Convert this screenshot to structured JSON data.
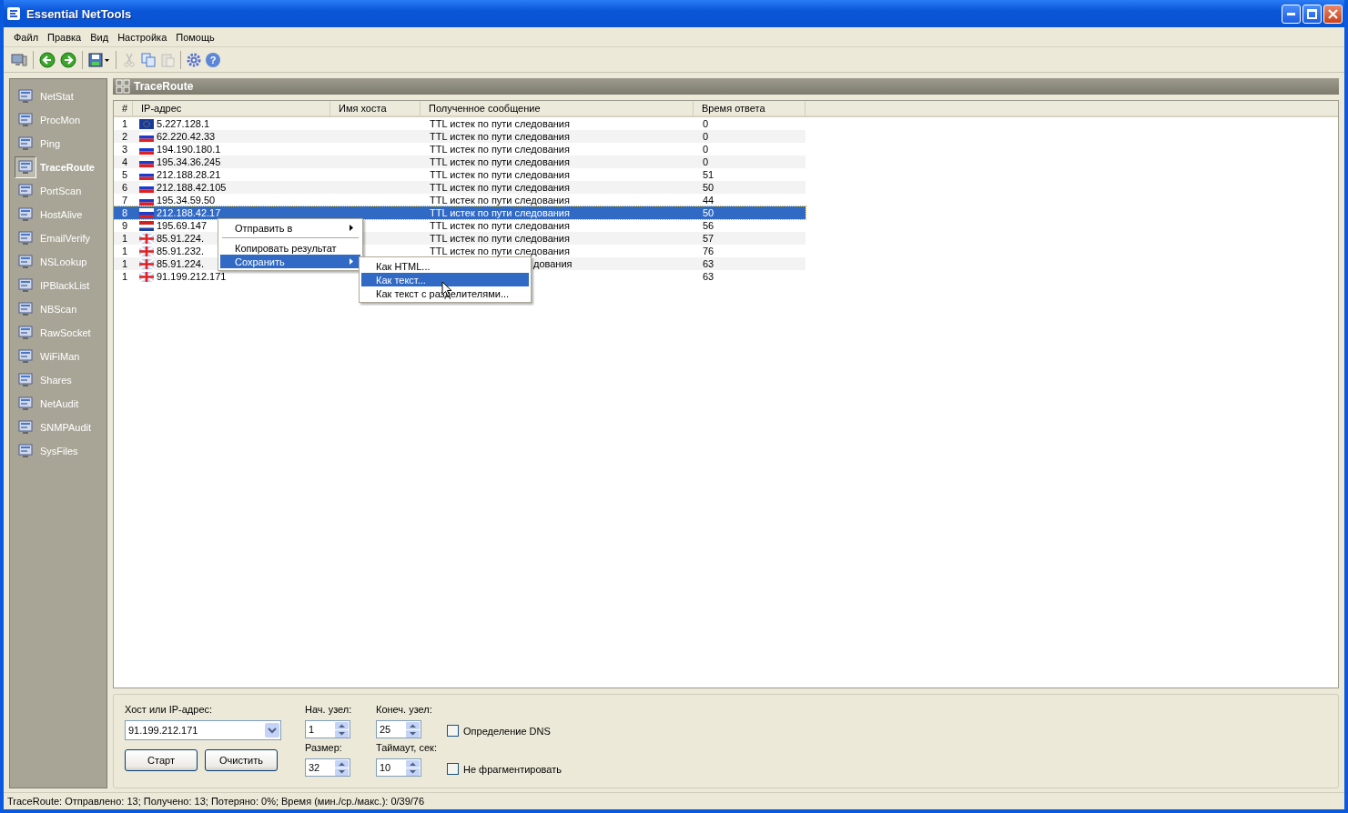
{
  "window": {
    "title": "Essential NetTools"
  },
  "menu": [
    "Файл",
    "Правка",
    "Вид",
    "Настройка",
    "Помощь"
  ],
  "toolbar": [
    [
      {
        "kind": "computer"
      }
    ],
    [
      {
        "kind": "back"
      },
      {
        "kind": "forward"
      }
    ],
    [
      {
        "kind": "save"
      }
    ],
    [
      {
        "kind": "cut",
        "disabled": true
      },
      {
        "kind": "copy",
        "disabled": false
      },
      {
        "kind": "paste",
        "disabled": true
      }
    ],
    [
      {
        "kind": "gear"
      },
      {
        "kind": "help",
        "glyph": "?"
      }
    ]
  ],
  "sidebar": {
    "items": [
      {
        "label": "NetStat",
        "selected": false
      },
      {
        "label": "ProcMon",
        "selected": false
      },
      {
        "label": "Ping",
        "selected": false
      },
      {
        "label": "TraceRoute",
        "selected": true
      },
      {
        "label": "PortScan",
        "selected": false
      },
      {
        "label": "HostAlive",
        "selected": false
      },
      {
        "label": "EmailVerify",
        "selected": false
      },
      {
        "label": "NSLookup",
        "selected": false
      },
      {
        "label": "IPBlackList",
        "selected": false
      },
      {
        "label": "NBScan",
        "selected": false
      },
      {
        "label": "RawSocket",
        "selected": false
      },
      {
        "label": "WiFiMan",
        "selected": false
      },
      {
        "label": "Shares",
        "selected": false
      },
      {
        "label": "NetAudit",
        "selected": false
      },
      {
        "label": "SNMPAudit",
        "selected": false
      },
      {
        "label": "SysFiles",
        "selected": false
      }
    ]
  },
  "panel": {
    "title": "TraceRoute"
  },
  "table": {
    "columns": [
      "#",
      "IP-адрес",
      "Имя хоста",
      "Полученное сообщение",
      "Время ответа"
    ],
    "rows": [
      {
        "n": "1",
        "kind": "eu",
        "ip": "5.227.128.1",
        "message": "TTL истек по пути следования",
        "time": "0",
        "selected": false
      },
      {
        "n": "2",
        "kind": "ru",
        "ip": "62.220.42.33",
        "message": "TTL истек по пути следования",
        "time": "0",
        "selected": false
      },
      {
        "n": "3",
        "kind": "ru",
        "ip": "194.190.180.1",
        "message": "TTL истек по пути следования",
        "time": "0",
        "selected": false
      },
      {
        "n": "4",
        "kind": "ru",
        "ip": "195.34.36.245",
        "message": "TTL истек по пути следования",
        "time": "0",
        "selected": false
      },
      {
        "n": "5",
        "kind": "ru",
        "ip": "212.188.28.21",
        "message": "TTL истек по пути следования",
        "time": "51",
        "selected": false
      },
      {
        "n": "6",
        "kind": "ru",
        "ip": "212.188.42.105",
        "message": "TTL истек по пути следования",
        "time": "50",
        "selected": false
      },
      {
        "n": "7",
        "kind": "ru",
        "ip": "195.34.59.50",
        "message": "TTL истек по пути следования",
        "time": "44",
        "selected": false
      },
      {
        "n": "8",
        "kind": "ru",
        "ip": "212.188.42.17",
        "message": "TTL истек по пути следования",
        "time": "50",
        "selected": true
      },
      {
        "n": "9",
        "kind": "nl",
        "ip": "195.69.147",
        "message": "TTL истек по пути следования",
        "time": "56",
        "selected": false
      },
      {
        "n": "1",
        "kind": "gb",
        "ip": "85.91.224.",
        "message": "TTL истек по пути следования",
        "time": "57",
        "selected": false
      },
      {
        "n": "1",
        "kind": "gb",
        "ip": "85.91.232.",
        "message": "TTL истек по пути следования",
        "time": "76",
        "selected": false
      },
      {
        "n": "1",
        "kind": "gb",
        "ip": "85.91.224.",
        "message": "дования",
        "message_covered": true,
        "time": "63",
        "selected": false
      },
      {
        "n": "1",
        "kind": "gb",
        "ip": "91.199.212.171",
        "time": "63",
        "selected": false
      }
    ]
  },
  "context_menu": {
    "items": [
      {
        "label": "Отправить в",
        "submenu": true,
        "selected": false
      },
      {
        "kind": "sep"
      },
      {
        "label": "Копировать результат",
        "submenu": false,
        "selected": false
      },
      {
        "label": "Сохранить",
        "submenu": true,
        "selected": true
      }
    ],
    "submenu": [
      {
        "label": "Как HTML...",
        "selected": false
      },
      {
        "label": "Как текст...",
        "selected": true
      },
      {
        "label": "Как текст с разделителями...",
        "selected": false
      }
    ]
  },
  "form": {
    "host_label": "Хост или IP-адрес:",
    "host_value": "91.199.212.171",
    "start_button": "Старт",
    "clear_button": "Очистить",
    "spinners": [
      {
        "label": "Нач. узел:",
        "value": "1"
      },
      {
        "label": "Конеч. узел:",
        "value": "25"
      },
      {
        "label": "Размер:",
        "value": "32"
      },
      {
        "label": "Таймаут, сек:",
        "value": "10"
      }
    ],
    "checkboxes": [
      {
        "label": "Определение DNS",
        "checked": false
      },
      {
        "label": "Не фрагментировать",
        "checked": false
      }
    ]
  },
  "status_bar": "TraceRoute: Отправлено: 13; Получено: 13; Потеряно: 0%; Время (мин./ср./макс.): 0/39/76"
}
